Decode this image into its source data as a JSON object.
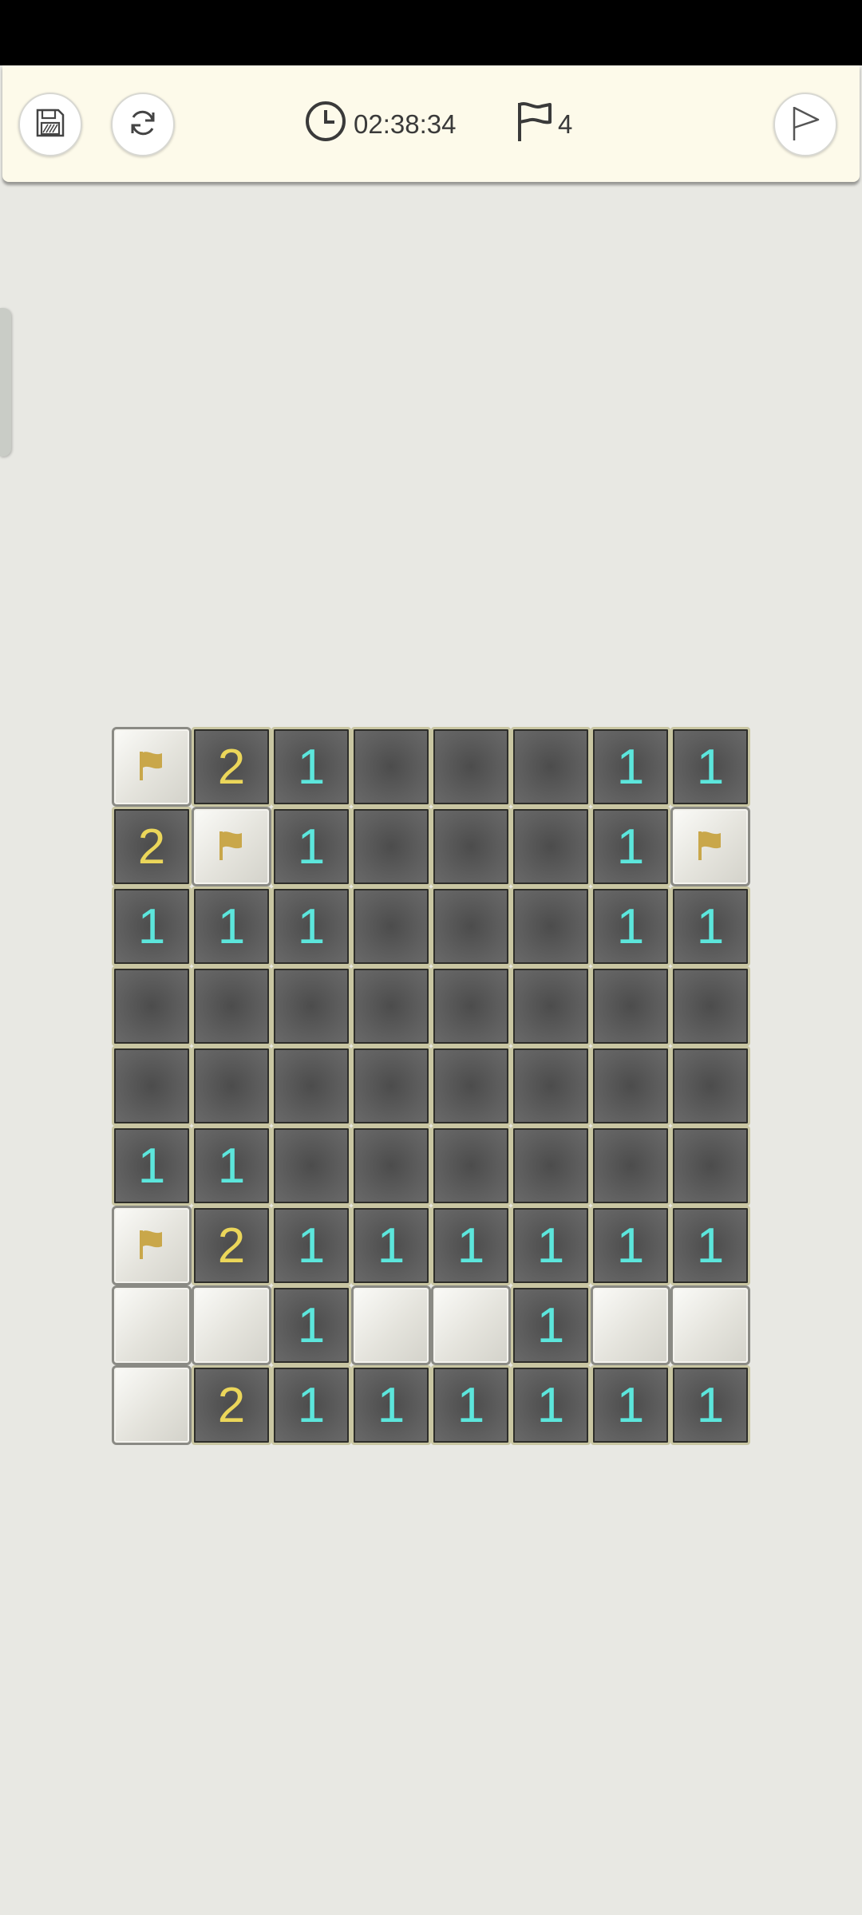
{
  "toolbar": {
    "timer": "02:38:34",
    "flag_count": "4",
    "save_icon": "save-icon",
    "restart_icon": "refresh-icon",
    "flag_mode_icon": "flag-outline-icon"
  },
  "colors": {
    "one": "#5ce6dc",
    "two": "#ebd65a",
    "flag": "#c9a74a"
  },
  "board": {
    "cols": 8,
    "rows": [
      [
        "F",
        "2",
        "1",
        "",
        "",
        "",
        "1",
        "1"
      ],
      [
        "2",
        "F",
        "1",
        "",
        "",
        "",
        "1",
        "F"
      ],
      [
        "1",
        "1",
        "1",
        "",
        "",
        "",
        "1",
        "1"
      ],
      [
        "",
        "",
        "",
        "",
        "",
        "",
        "",
        ""
      ],
      [
        "",
        "",
        "",
        "",
        "",
        "",
        "",
        ""
      ],
      [
        "1",
        "1",
        "",
        "",
        "",
        "",
        "",
        ""
      ],
      [
        "F",
        "2",
        "1",
        "1",
        "1",
        "1",
        "1",
        "1"
      ],
      [
        "H",
        "H",
        "1",
        "H",
        "H",
        "1",
        "H",
        "H"
      ],
      [
        "H",
        "2",
        "1",
        "1",
        "1",
        "1",
        "1",
        "1"
      ]
    ]
  }
}
